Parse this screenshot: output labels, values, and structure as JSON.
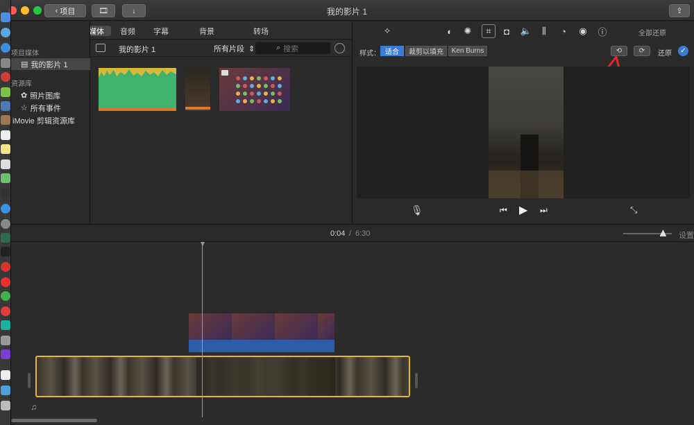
{
  "window": {
    "title": "我的影片 1",
    "back_label": "项目"
  },
  "media_tabs": [
    "我的媒体",
    "音频",
    "字幕",
    "背景",
    "转场"
  ],
  "library": {
    "section1": "项目媒体",
    "project_item": "我的影片 1",
    "section2": "资源库",
    "items": [
      "照片图库",
      "所有事件",
      "iMovie 剪辑资源库"
    ]
  },
  "browser": {
    "title": "我的影片 1",
    "filter": "所有片段",
    "search_placeholder": "搜索"
  },
  "viewer": {
    "reset_all": "全部还原",
    "style_label": "样式：",
    "styles": [
      "适合",
      "裁剪以填充",
      "Ken Burns"
    ],
    "reset": "还原"
  },
  "timeline": {
    "current_time": "0:04",
    "separator": "/",
    "total_time": "6:30",
    "settings": "设置",
    "zoom_level": 0.82
  },
  "colors": {
    "accent": "#3a7bd5",
    "clip_border": "#e6b82e",
    "audio_green": "#3fb26b",
    "arrow_red": "#e2262b"
  }
}
